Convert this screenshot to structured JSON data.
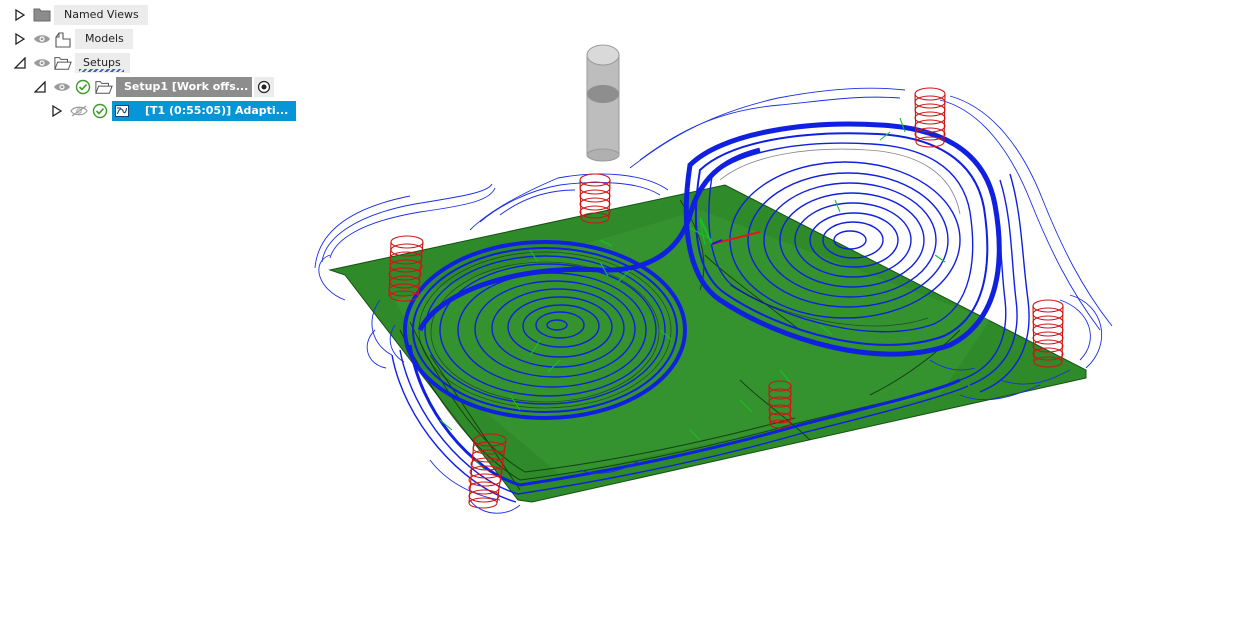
{
  "browser": {
    "named_views": {
      "label": "Named Views",
      "icon": "folder-icon"
    },
    "models": {
      "label": "Models",
      "icon": "models-icon"
    },
    "setups": {
      "label": "Setups",
      "icon": "setups-folder-icon"
    },
    "setup1": {
      "label": "Setup1 [Work offs...",
      "icon": "setup-icon"
    },
    "operation": {
      "label": "[T1 (0:55:05)] Adapti...",
      "icon": "toolpath-icon"
    }
  },
  "colors": {
    "stock_green": "#2f8a2a",
    "toolpath_blue": "#1020e0",
    "helix_red": "#d01414",
    "selection_blue": "#0696d7",
    "setup_gray": "#8d8d8d",
    "tool_gray": "#bdbdbd"
  }
}
